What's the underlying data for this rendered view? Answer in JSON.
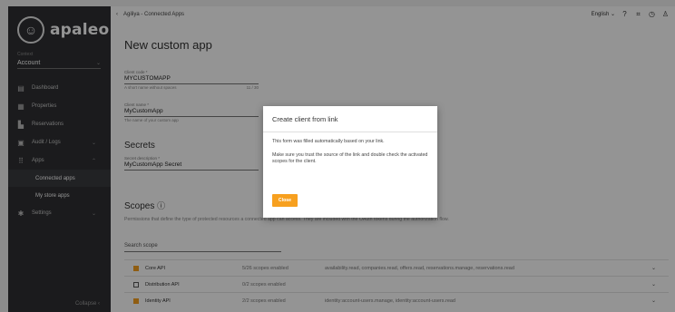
{
  "app": {
    "brand": "apaleo"
  },
  "context": {
    "label": "Context",
    "value": "Account"
  },
  "sidebar": {
    "items": [
      {
        "label": "Dashboard",
        "icon": "dashboard-icon"
      },
      {
        "label": "Properties",
        "icon": "properties-icon"
      },
      {
        "label": "Reservations",
        "icon": "reservations-icon"
      },
      {
        "label": "Audit / Logs",
        "icon": "audit-icon"
      },
      {
        "label": "Apps",
        "icon": "apps-grid-icon"
      },
      {
        "label": "Connected apps"
      },
      {
        "label": "My store apps"
      },
      {
        "label": "Settings",
        "icon": "gear-icon"
      }
    ],
    "collapse_label": "Collapse"
  },
  "topbar": {
    "breadcrumb": "Agiliya - Connected Apps",
    "language": "English"
  },
  "page": {
    "title": "New custom app"
  },
  "form": {
    "client_code": {
      "label": "Client code *",
      "value": "MYCUSTOMAPP",
      "hint": "A short name without spaces",
      "counter": "11 / 30"
    },
    "client_name": {
      "label": "Client name *",
      "value": "MyCustomApp",
      "hint": "The name of your custom app"
    },
    "secrets_heading": "Secrets",
    "secret_description": {
      "label": "Secret description *",
      "value": "MyCustomApp Secret"
    },
    "scopes_heading": "Scopes",
    "scopes_description": "Permissions that define the type of protected resources a connected app can access. They are included with the OAuth tokens during the authorization flow.",
    "search_placeholder": "Search scope"
  },
  "scopes": [
    {
      "name": "Core API",
      "count": "5/26 scopes enabled",
      "list": "availability.read, companies.read, offers.read, reservations.manage, reservations.read",
      "state": "partial"
    },
    {
      "name": "Distribution API",
      "count": "0/2 scopes enabled",
      "list": "",
      "state": "none"
    },
    {
      "name": "Identity API",
      "count": "2/2 scopes enabled",
      "list": "identity:account-users.manage, identity:account-users.read",
      "state": "all"
    }
  ],
  "dialog": {
    "title": "Create client from link",
    "paragraph1": "This form was filled automatically based on your link.",
    "paragraph2": "Make sure you trust the source of the link and double check the activated scopes for the client.",
    "close_label": "Close"
  },
  "colors": {
    "accent": "#f7a01f",
    "sidebar_bg": "#2f3033"
  }
}
